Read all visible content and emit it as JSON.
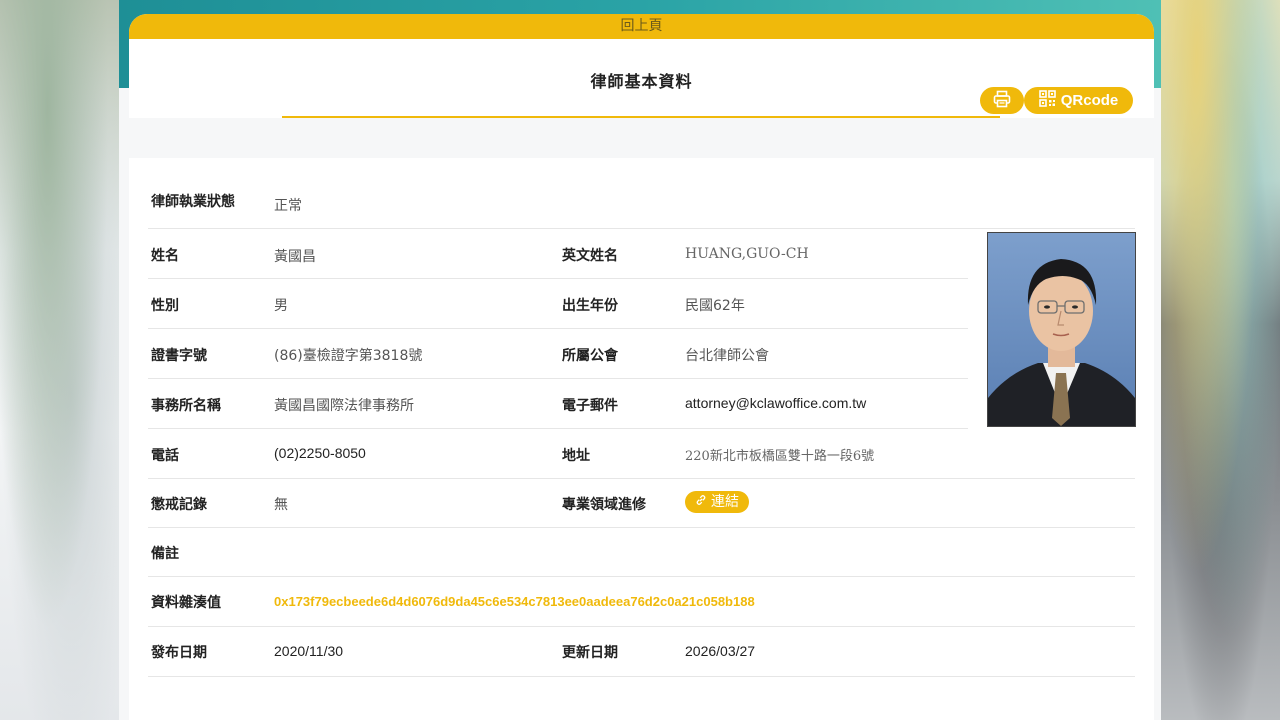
{
  "nav": {
    "back_label": "回上頁"
  },
  "page": {
    "title": "律師基本資料"
  },
  "actions": {
    "qr_label": "QRcode"
  },
  "profile": {
    "status_label": "律師執業狀態",
    "status_value": "正常",
    "name_label": "姓名",
    "name_value": "黃國昌",
    "en_name_label": "英文姓名",
    "en_name_value": "HUANG,GUO-CH",
    "gender_label": "性別",
    "gender_value": "男",
    "birth_label": "出生年份",
    "birth_value": "民國62年",
    "cert_label": "證書字號",
    "cert_value": "(86)臺檢證字第3818號",
    "assoc_label": "所屬公會",
    "assoc_value": "台北律師公會",
    "firm_label": "事務所名稱",
    "firm_value": "黃國昌國際法律事務所",
    "email_label": "電子郵件",
    "email_value": "attorney@kclawoffice.com.tw",
    "phone_label": "電話",
    "phone_value": "(02)2250-8050",
    "address_label": "地址",
    "address_value": "220新北市板橋區雙十路一段6號",
    "discipline_label": "懲戒記錄",
    "discipline_value": "無",
    "specialty_label": "專業領域進修",
    "specialty_link": "連結",
    "note_label": "備註",
    "note_value": "",
    "hash_label": "資料雜湊值",
    "hash_value": "0x173f79ecbeede6d4d6076d9da45c6e534c7813ee0aadeea76d2c0a21c058b188",
    "publish_label": "發布日期",
    "publish_value": "2020/11/30",
    "update_label": "更新日期",
    "update_value": "2026/03/27"
  },
  "colors": {
    "accent": "#f0b90b",
    "banner": "#2aa3a6"
  }
}
